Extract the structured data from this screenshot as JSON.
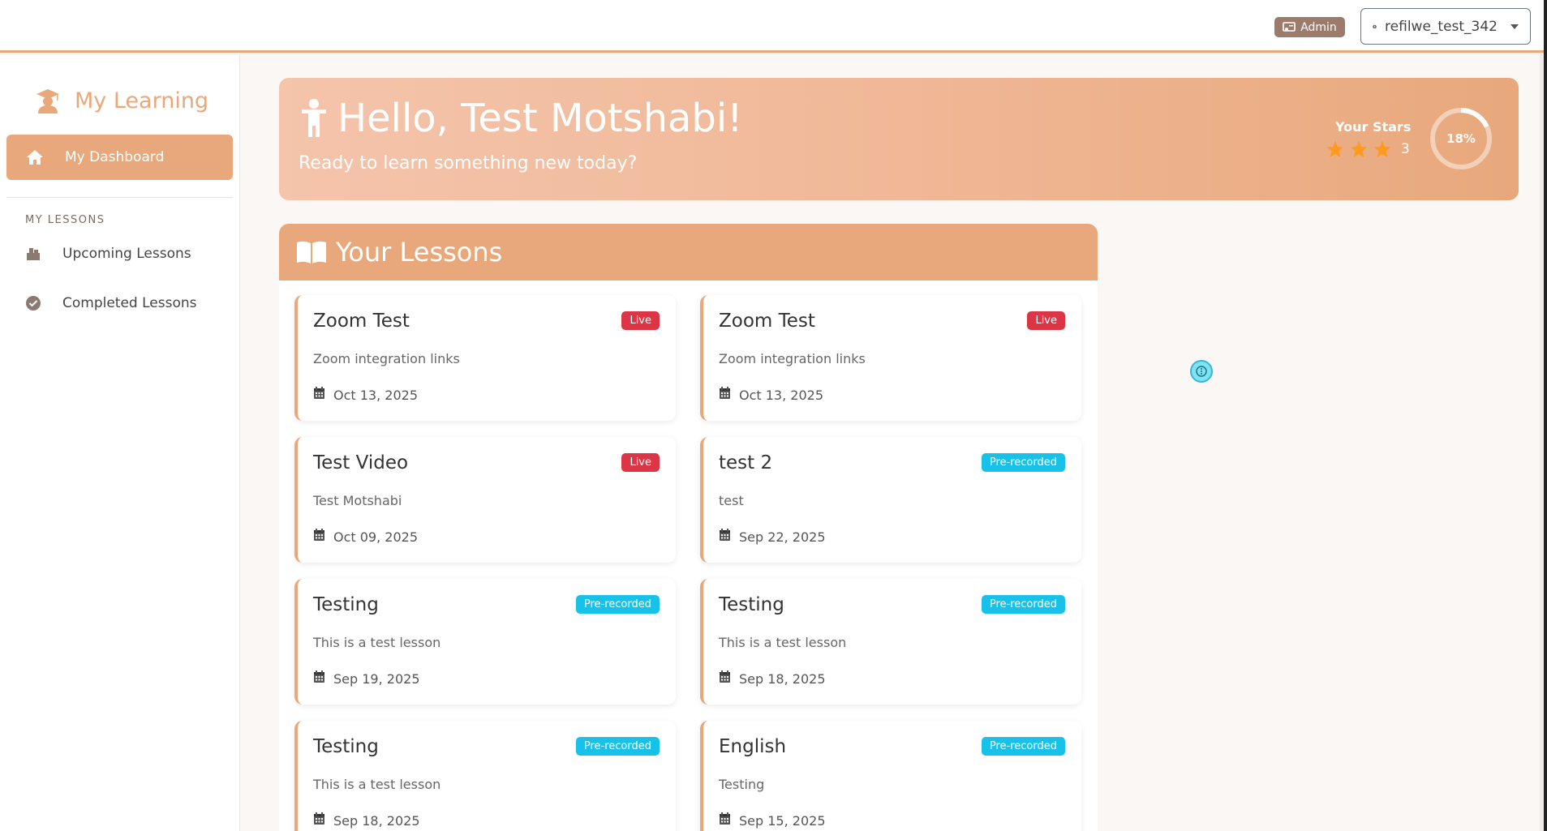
{
  "topbar": {
    "admin_label": "Admin",
    "username": "refilwe_test_342"
  },
  "sidebar": {
    "brand": "My Learning",
    "active_item": "My Dashboard",
    "section_label": "MY LESSONS",
    "items": [
      {
        "label": "Upcoming Lessons",
        "icon": "box-icon"
      },
      {
        "label": "Completed Lessons",
        "icon": "check-circle-icon"
      }
    ]
  },
  "hero": {
    "greeting": "Hello, Test Motshabi!",
    "subtitle": "Ready to learn something new today?",
    "stars_label": "Your Stars",
    "stars_count": "3",
    "progress_label": "18%",
    "progress": 0.18
  },
  "lessons": {
    "header": "Your Lessons",
    "cards": [
      {
        "title": "Zoom Test",
        "badge": "Live",
        "description": "Zoom integration links",
        "date": "Oct 13, 2025"
      },
      {
        "title": "Zoom Test",
        "badge": "Live",
        "description": "Zoom integration links",
        "date": "Oct 13, 2025"
      },
      {
        "title": "Test Video",
        "badge": "Live",
        "description": "Test Motshabi",
        "date": "Oct 09, 2025"
      },
      {
        "title": "test 2",
        "badge": "Pre-recorded",
        "description": "test",
        "date": "Sep 22, 2025"
      },
      {
        "title": "Testing",
        "badge": "Pre-recorded",
        "description": "This is a test lesson",
        "date": "Sep 19, 2025"
      },
      {
        "title": "Testing",
        "badge": "Pre-recorded",
        "description": "This is a test lesson",
        "date": "Sep 18, 2025"
      },
      {
        "title": "Testing",
        "badge": "Pre-recorded",
        "description": "This is a test lesson",
        "date": "Sep 18, 2025"
      },
      {
        "title": "English",
        "badge": "Pre-recorded",
        "description": "Testing",
        "date": "Sep 15, 2025"
      }
    ]
  },
  "colors": {
    "accent": "#e8a87c",
    "live": "#dc3545",
    "prerecorded": "#17c1e8"
  }
}
